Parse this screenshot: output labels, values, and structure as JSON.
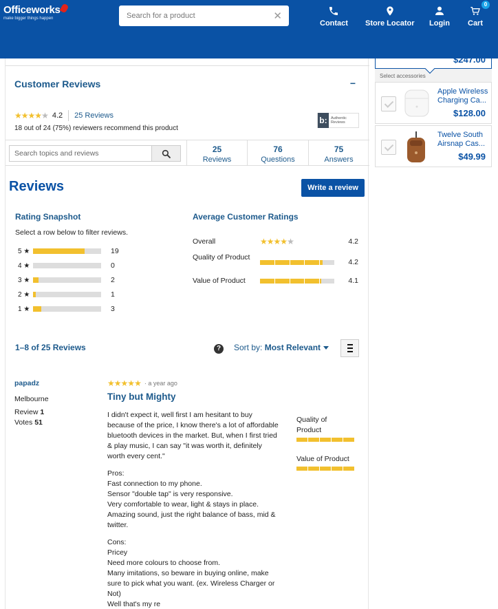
{
  "header": {
    "brand": "Officeworks",
    "tagline": "make bigger things happen",
    "search_placeholder": "Search for a product",
    "nav": [
      {
        "label": "Contact",
        "icon": "phone-icon"
      },
      {
        "label": "Store Locator",
        "icon": "location-pin-icon"
      },
      {
        "label": "Login",
        "icon": "user-icon"
      },
      {
        "label": "Cart",
        "icon": "cart-icon"
      }
    ],
    "cart_count": "0",
    "colors": {
      "primary": "#0a52a5",
      "accent": "#1aa3e8",
      "logo_pin": "#e2231a"
    }
  },
  "sidebar": {
    "main_price": "$247.00",
    "accessories_label": "Select accessories",
    "accessories": [
      {
        "name": "Apple Wireless Charging Ca...",
        "price": "$128.00"
      },
      {
        "name": "Twelve South Airsnap Cas...",
        "price": "$49.99"
      }
    ]
  },
  "reviews_section": {
    "title": "Customer Reviews",
    "collapse_symbol": "−",
    "average": "4.2",
    "average_stars": 4.2,
    "reviews_link": "25 Reviews",
    "recommend": "18 out of 24 (75%) reviewers recommend this product",
    "badge_letter": "b:",
    "badge_text": "Authentic Reviews",
    "search_placeholder": "Search topics and reviews",
    "stats": [
      {
        "count": "25",
        "label": "Reviews"
      },
      {
        "count": "76",
        "label": "Questions"
      },
      {
        "count": "75",
        "label": "Answers"
      }
    ],
    "heading": "Reviews",
    "write_button": "Write a review",
    "snapshot": {
      "title": "Rating Snapshot",
      "subtitle": "Select a row below to filter reviews.",
      "rows": [
        {
          "label": "5 ★",
          "count": 19,
          "fraction": 0.76
        },
        {
          "label": "4 ★",
          "count": 0,
          "fraction": 0
        },
        {
          "label": "3 ★",
          "count": 2,
          "fraction": 0.08
        },
        {
          "label": "2 ★",
          "count": 1,
          "fraction": 0.04
        },
        {
          "label": "1 ★",
          "count": 3,
          "fraction": 0.12
        }
      ]
    },
    "averages": {
      "title": "Average Customer Ratings",
      "overall_label": "Overall",
      "overall_value": "4.2",
      "rows": [
        {
          "label": "Quality of Product",
          "value": "4.2",
          "score": 4.2
        },
        {
          "label": "Value of Product",
          "value": "4.1",
          "score": 4.1
        }
      ]
    },
    "count_label": "1–8 of 25 Reviews",
    "help_symbol": "?",
    "sort_label": "Sort by:",
    "sort_value": "Most Relevant"
  },
  "review": {
    "author": "papadz",
    "location": "Melbourne",
    "review_label": "Review",
    "review_count": "1",
    "votes_label": "Votes",
    "votes_count": "51",
    "stars": 5,
    "ago": "· a year ago",
    "title": "Tiny but Mighty",
    "paragraphs": [
      "I didn't expect it, well first I am hesitant to buy because of the price, I know there's a lot of affordable bluetooth devices in the market. But, when I first tried & play music, I can say \"it was worth it, definitely worth every cent.\"",
      "Pros:\nFast connection to my phone.\nSensor \"double tap\" is very responsive.\nVery comfortable to wear, light & stays in place.\nAmazing sound, just the right balance of bass, mid & twitter.",
      "Cons:\nPricey\nNeed more colours to choose from.\nMany imitations, so beware in buying online, make sure to pick what you want. (ex. Wireless Charger or Not)\nWell that's my re"
    ],
    "ratings": [
      {
        "label": "Quality of Product",
        "score": 5
      },
      {
        "label": "Value of Product",
        "score": 5
      }
    ]
  }
}
